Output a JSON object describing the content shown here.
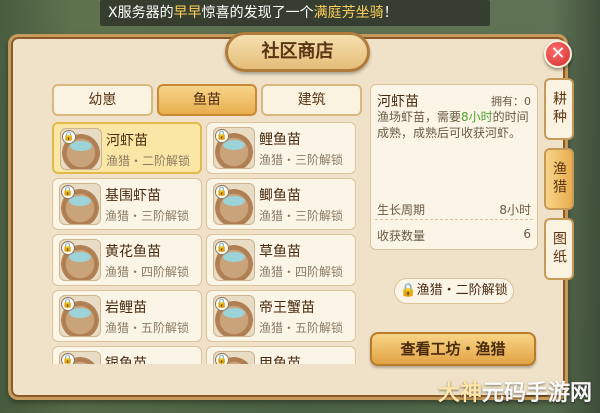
{
  "ticker": {
    "prefix": "X服务器的",
    "name": "早早",
    "middle": "惊喜的发现了一个",
    "item": "满庭芳坐骑",
    "suffix": "！"
  },
  "panel": {
    "title": "社区商店",
    "close": "✕"
  },
  "tabs": [
    {
      "label": "幼崽"
    },
    {
      "label": "鱼苗"
    },
    {
      "label": "建筑"
    }
  ],
  "items": [
    {
      "name": "河虾苗",
      "lock": "渔猎・二阶解锁"
    },
    {
      "name": "鲤鱼苗",
      "lock": "渔猎・三阶解锁"
    },
    {
      "name": "基围虾苗",
      "lock": "渔猎・三阶解锁"
    },
    {
      "name": "鲫鱼苗",
      "lock": "渔猎・三阶解锁"
    },
    {
      "name": "黄花鱼苗",
      "lock": "渔猎・四阶解锁"
    },
    {
      "name": "草鱼苗",
      "lock": "渔猎・四阶解锁"
    },
    {
      "name": "岩鲤苗",
      "lock": "渔猎・五阶解锁"
    },
    {
      "name": "帝王蟹苗",
      "lock": "渔猎・五阶解锁"
    },
    {
      "name": "银鱼苗",
      "lock": ""
    },
    {
      "name": "甲鱼苗",
      "lock": ""
    }
  ],
  "detail": {
    "name": "河虾苗",
    "own": "拥有：0",
    "desc_a": "渔场虾苗，需要",
    "desc_hl": "8小时",
    "desc_b": "的时间成熟，成熟后可收获河虾。",
    "cycle_label": "生长周期",
    "cycle_value": "8小时",
    "harvest_label": "收获数量",
    "harvest_value": "6",
    "requirement": "渔猎・二阶解锁",
    "action": "查看工坊・渔猎"
  },
  "side": [
    {
      "label": "耕种"
    },
    {
      "label": "渔猎"
    },
    {
      "label": "图纸"
    }
  ],
  "watermark": {
    "a": "大神",
    "b": "元码手游网"
  },
  "colors": {
    "accent": "#e8ad4e",
    "panel": "#efe2c8",
    "border": "#c79a5a",
    "highlight": "#4fa32d"
  }
}
